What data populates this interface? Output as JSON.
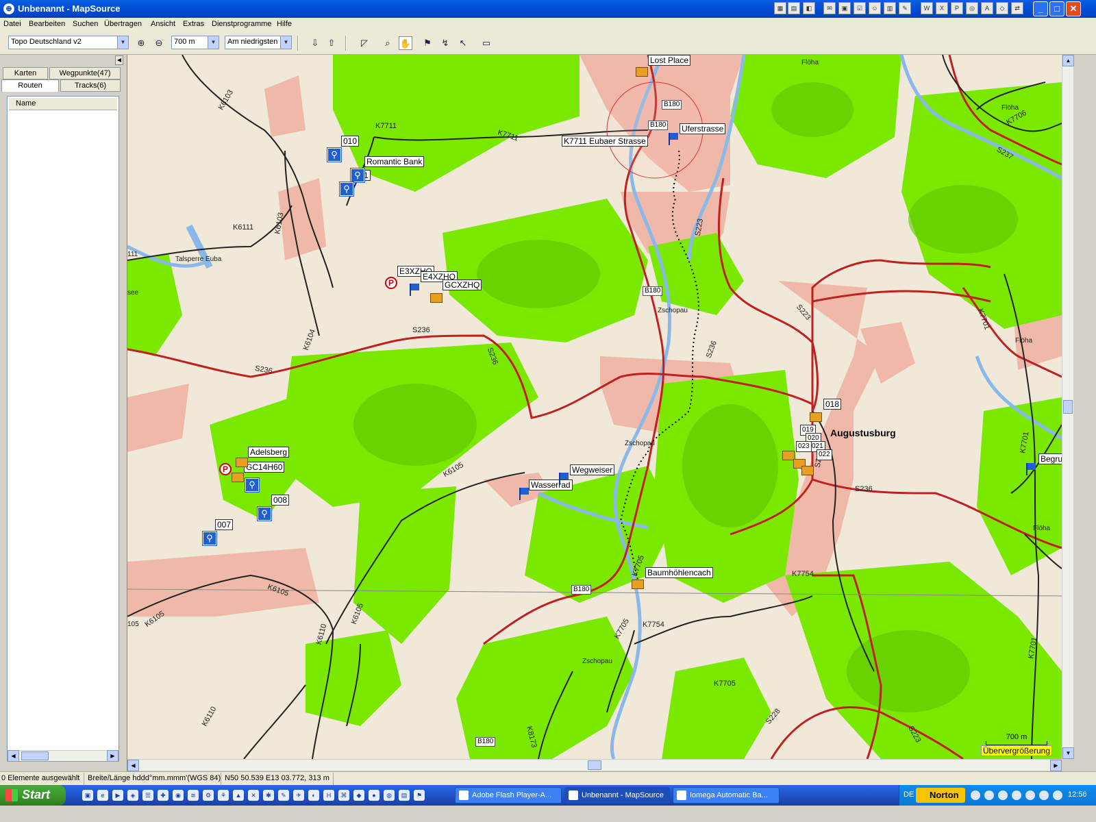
{
  "window": {
    "title": "Unbenannt - MapSource",
    "controls": {
      "minimize": "_",
      "maximize": "□",
      "close": "✕"
    }
  },
  "menubar": {
    "items": [
      "Datei",
      "Bearbeiten",
      "Suchen",
      "Übertragen",
      "Ansicht",
      "Extras",
      "Dienstprogramme",
      "Hilfe"
    ]
  },
  "toolbar": {
    "map_product": "Topo Deutschland v2",
    "zoom_level": "700 m",
    "detail_level": "Am niedrigsten",
    "icons": [
      "zoom-in-icon",
      "zoom-out-icon",
      "receive-from-device-icon",
      "send-to-device-icon",
      "selection-icon",
      "zoom-tool-icon",
      "hand-tool-icon",
      "waypoint-tool-icon",
      "route-tool-icon",
      "pointer-tool-icon",
      "measure-tool-icon"
    ]
  },
  "sidepanel": {
    "tabs": [
      "Karten",
      "Wegpunkte(47)",
      "Routen",
      "Tracks(6)"
    ],
    "active_tab": "Routen",
    "list_header": "Name"
  },
  "map": {
    "waypoint_labels": [
      "Lost Place",
      "Uferstrasse",
      "K7711 Eubaer Strasse",
      "Romantic Bank",
      "010",
      "1",
      "E3XZHQ",
      "E4XZHQ",
      "GCXZHQ",
      "Adelsberg",
      "GC14H60",
      "008",
      "007",
      "Wegweiser",
      "Wasserrad",
      "Baumhöhlencach",
      "018",
      "019",
      "020",
      "021",
      "022",
      "023"
    ],
    "road_labels": [
      "K7711",
      "K7711",
      "K6103",
      "K6111",
      "K6103",
      "S236",
      "S236",
      "S236",
      "S236",
      "S223",
      "S223",
      "S223",
      "K6105",
      "K6105",
      "K6105",
      "K6110",
      "K6110",
      "K7705",
      "K7705",
      "K7705",
      "K7754",
      "K7754",
      "S228",
      "S236",
      "K7706",
      "K7701",
      "K7701",
      "K7701",
      "K8173",
      "S237",
      "S2",
      "K6104",
      "K6105"
    ],
    "road_boxes": [
      "B180",
      "B180",
      "B180",
      "B180",
      "B180"
    ],
    "place_labels": [
      "Talsperre Euba",
      "Flöha",
      "Flöha",
      "Flöha",
      "Flöha",
      "Zschopau",
      "Zschopau",
      "Zschopau",
      "111",
      "see",
      "105",
      "Begru"
    ],
    "city": "Augustusburg",
    "scale_distance": "700 m",
    "zoom_warning": "Übervergrößerung"
  },
  "statusbar": {
    "selection": "0 Elemente ausgewählt",
    "coord_format": "Breite/Länge hddd°mm.mmm'(WGS 84)",
    "cursor_position": "N50 50.539 E13 03.772, 313 m"
  },
  "taskbar": {
    "start_label": "Start",
    "tasks": [
      "Adobe Flash Player-A...",
      "Unbenannt - MapSource",
      "Iomega Automatic Ba..."
    ],
    "active_task": "Unbenannt - MapSource",
    "language": "DE",
    "norton": "Norton",
    "clock": "12:56"
  },
  "colors": {
    "forest": "#7be800",
    "forest_dark": "#5cc400",
    "urban": "#f0b8a8",
    "terrain": "#f0e8d8",
    "water": "#8ab8e8",
    "primary_road": "#c02020",
    "secondary_road": "#222222",
    "track": "#000000"
  }
}
